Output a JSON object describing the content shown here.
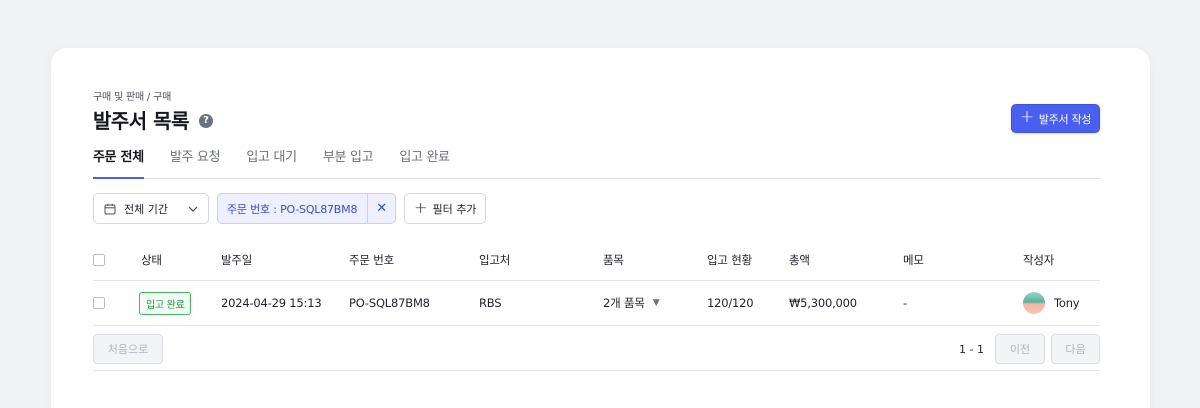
{
  "breadcrumb": "구매 및 판매 / 구매",
  "page_title": "발주서 목록",
  "help_icon": "?",
  "create_button": {
    "icon": "plus-icon",
    "label": "발주서 작성"
  },
  "colors": {
    "accent": "#4a5ff0",
    "success": "#26973f",
    "background": "#f1f2f4"
  },
  "tabs": [
    {
      "label": "주문 전체",
      "active": true
    },
    {
      "label": "발주 요청",
      "active": false
    },
    {
      "label": "입고 대기",
      "active": false
    },
    {
      "label": "부분 입고",
      "active": false
    },
    {
      "label": "입고 완료",
      "active": false
    }
  ],
  "filters": {
    "date_range": {
      "icon": "calendar-icon",
      "label": "전체 기간"
    },
    "active_chip": {
      "label": "주문 번호 : PO-SQL87BM8",
      "close": "✕"
    },
    "add_filter": {
      "icon": "plus-icon",
      "label": "필터 추가"
    }
  },
  "table": {
    "headers": {
      "status": "상태",
      "order_date": "발주일",
      "order_number": "주문 번호",
      "vendor": "입고처",
      "items": "품목",
      "receipt_status": "입고 현황",
      "total": "총액",
      "memo": "메모",
      "author": "작성자"
    },
    "rows": [
      {
        "status": "입고 완료",
        "order_date": "2024-04-29 15:13",
        "order_number": "PO-SQL87BM8",
        "vendor": "RBS",
        "items": "2개 품목",
        "receipt_status": "120/120",
        "total": "₩5,300,000",
        "memo": "-",
        "author": "Tony"
      }
    ]
  },
  "pagination": {
    "first_label": "처음으로",
    "page_info": "1 - 1",
    "prev_label": "이전",
    "next_label": "다음"
  }
}
